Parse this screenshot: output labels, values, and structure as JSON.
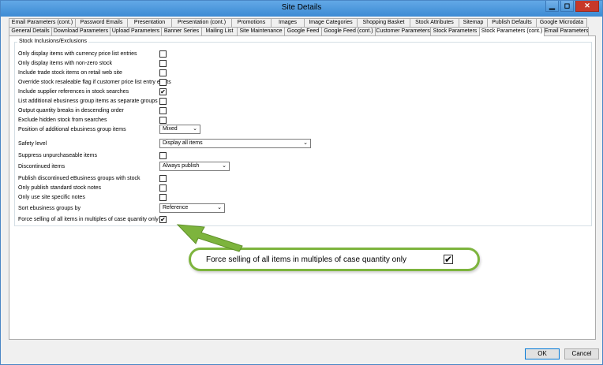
{
  "window": {
    "title": "Site Details",
    "minimize": "▁",
    "maximize": "◻",
    "close": "✕"
  },
  "tabs_row1": [
    {
      "label": "Email Parameters (cont.)"
    },
    {
      "label": "Password Emails"
    },
    {
      "label": "Presentation"
    },
    {
      "label": "Presentation (cont.)"
    },
    {
      "label": "Promotions"
    },
    {
      "label": "Images"
    },
    {
      "label": "Image Categories"
    },
    {
      "label": "Shopping Basket"
    },
    {
      "label": "Stock Attributes"
    },
    {
      "label": "Sitemap"
    },
    {
      "label": "Publish Defaults"
    },
    {
      "label": "Google Microdata"
    }
  ],
  "tabs_row2": [
    {
      "label": "General Details"
    },
    {
      "label": "Download Parameters"
    },
    {
      "label": "Upload Parameters"
    },
    {
      "label": "Banner Series"
    },
    {
      "label": "Mailing List"
    },
    {
      "label": "Site Maintenance"
    },
    {
      "label": "Google Feed"
    },
    {
      "label": "Google Feed (cont.)"
    },
    {
      "label": "Customer Parameters"
    },
    {
      "label": "Stock Parameters"
    },
    {
      "label": "Stock Parameters (cont.)"
    },
    {
      "label": "Email Parameters"
    }
  ],
  "group": {
    "title": "Stock Inclusions/Exclusions"
  },
  "settings": [
    {
      "label": "Only display items with currency price list entries",
      "type": "checkbox",
      "checked": false
    },
    {
      "label": "Only display items with non-zero stock",
      "type": "checkbox",
      "checked": false
    },
    {
      "label": "Include trade stock items on retail web site",
      "type": "checkbox",
      "checked": false
    },
    {
      "label": "Override stock resaleable flag if customer price list entry exists",
      "type": "checkbox",
      "checked": false
    },
    {
      "label": "Include supplier references in stock searches",
      "type": "checkbox",
      "checked": true
    },
    {
      "label": "List additional ebusiness group items as separate groups",
      "type": "checkbox",
      "checked": false
    },
    {
      "label": "Output quantity breaks in descending order",
      "type": "checkbox",
      "checked": false
    },
    {
      "label": "Exclude hidden stock from searches",
      "type": "checkbox",
      "checked": false
    },
    {
      "label": "Position of additional ebusiness group items",
      "type": "select",
      "value": "Mixed"
    },
    {
      "label": "Safety level",
      "type": "select",
      "value": "Display all items"
    },
    {
      "label": "Suppress unpurchaseable items",
      "type": "checkbox",
      "checked": false
    },
    {
      "label": "Discontinued items",
      "type": "select",
      "value": "Always publish"
    },
    {
      "label": "Publish discontinued eBusiness groups with stock",
      "type": "checkbox",
      "checked": false
    },
    {
      "label": "Only publish standard stock notes",
      "type": "checkbox",
      "checked": false
    },
    {
      "label": "Only use site specific notes",
      "type": "checkbox",
      "checked": false
    },
    {
      "label": "Sort ebusiness groups by",
      "type": "select",
      "value": "Reference"
    },
    {
      "label": "Force selling of all items in multiples of case quantity only",
      "type": "checkbox",
      "checked": true
    }
  ],
  "callout": {
    "label": "Force selling of all items in multiples of case quantity only",
    "check": "✔"
  },
  "check_glyph": "✔",
  "chevron_glyph": "⌄",
  "buttons": {
    "ok": "OK",
    "cancel": "Cancel"
  },
  "colors": {
    "callout_border": "#7db43d",
    "titlebar": "#3d8bd4",
    "close": "#c7382a"
  }
}
